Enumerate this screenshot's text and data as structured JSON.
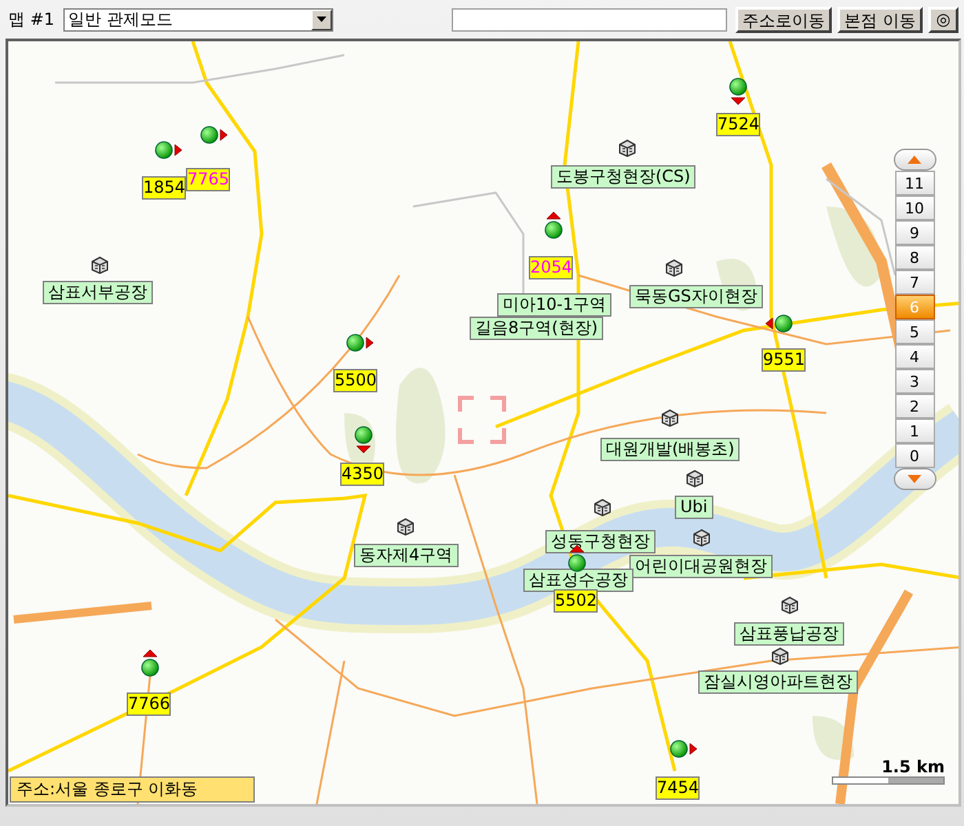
{
  "toolbar": {
    "map_label": "맵 #1",
    "mode_select": {
      "value": "일반 관제모드"
    },
    "buttons": [
      {
        "kind": "text",
        "label": "주소로이동"
      },
      {
        "kind": "text",
        "label": "본점 이동"
      },
      {
        "kind": "icon",
        "label": "◎"
      }
    ]
  },
  "map": {
    "vehicles": [
      {
        "number": "1854",
        "kind": "right",
        "highlighted": false
      },
      {
        "number": "7765",
        "kind": "right",
        "highlighted": true
      },
      {
        "number": "7524",
        "kind": "down",
        "highlighted": false
      },
      {
        "number": "2054",
        "kind": "up",
        "highlighted": true
      },
      {
        "number": "5500",
        "kind": "right",
        "highlighted": false
      },
      {
        "number": "9551",
        "kind": "left",
        "highlighted": false
      },
      {
        "number": "4350",
        "kind": "down",
        "highlighted": false
      },
      {
        "number": "5502",
        "kind": "up",
        "highlighted": false
      },
      {
        "number": "7766",
        "kind": "up",
        "highlighted": false
      },
      {
        "number": "7454",
        "kind": "right",
        "highlighted": false
      }
    ],
    "sites": [
      {
        "name": "삼표서부공장"
      },
      {
        "name": "도봉구청현장(CS)"
      },
      {
        "name": "미아10-1구역"
      },
      {
        "name": "길음8구역(현장)"
      },
      {
        "name": "묵동GS자이현장"
      },
      {
        "name": "대원개발(배봉초)"
      },
      {
        "name": "Ubi"
      },
      {
        "name": "성동구청현장"
      },
      {
        "name": "어린이대공원현장"
      },
      {
        "name": "삼표성수공장"
      },
      {
        "name": "동자제4구역"
      },
      {
        "name": "삼표풍납공장"
      },
      {
        "name": "잠실시영아파트현장"
      }
    ],
    "zoom_control": {
      "levels": [
        {
          "label": "11",
          "selected": false
        },
        {
          "label": "10",
          "selected": false
        },
        {
          "label": "9",
          "selected": false
        },
        {
          "label": "8",
          "selected": false
        },
        {
          "label": "7",
          "selected": false
        },
        {
          "label": "6",
          "selected": true
        },
        {
          "label": "5",
          "selected": false
        },
        {
          "label": "4",
          "selected": false
        },
        {
          "label": "3",
          "selected": false
        },
        {
          "label": "2",
          "selected": false
        },
        {
          "label": "1",
          "selected": false
        },
        {
          "label": "0",
          "selected": false
        }
      ]
    },
    "scale": "1.5 km",
    "address": "주소:서울 종로구 이화동"
  }
}
